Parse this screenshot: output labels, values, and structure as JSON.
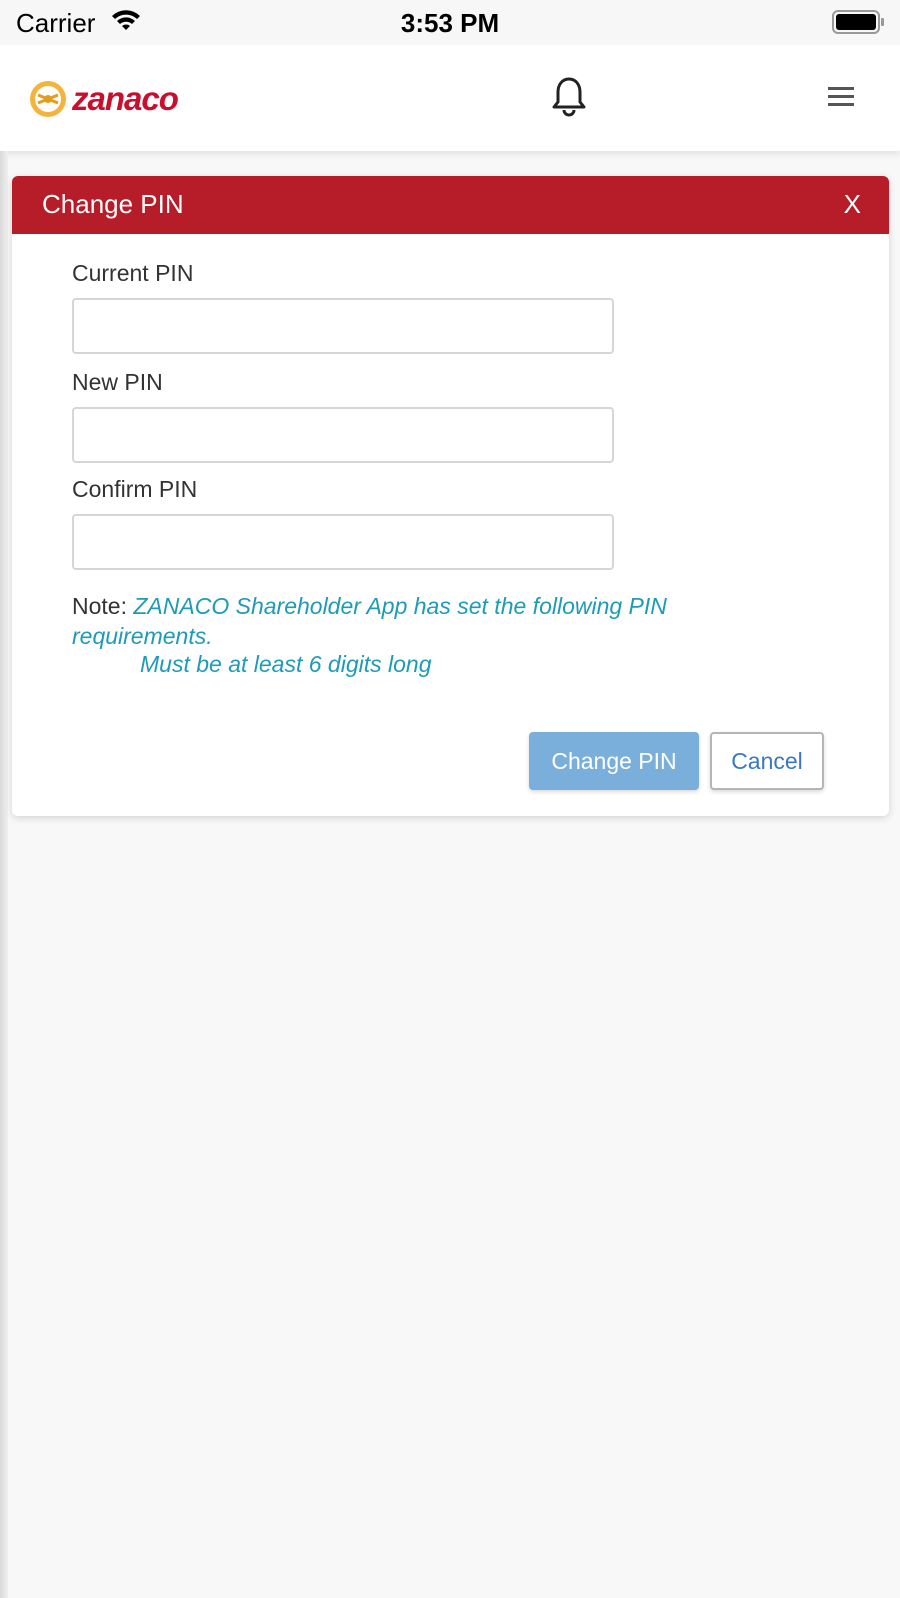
{
  "status_bar": {
    "carrier": "Carrier",
    "time": "3:53 PM",
    "icons": [
      "wifi-icon",
      "battery-icon"
    ]
  },
  "header": {
    "logo_text": "zanaco",
    "brand_color": "#c8102e",
    "icons": [
      "bell-icon",
      "menu-icon"
    ]
  },
  "dialog": {
    "title": "Change PIN",
    "close_label": "X",
    "header_color": "#b71c29",
    "fields": [
      {
        "label": "Current PIN",
        "value": ""
      },
      {
        "label": "New PIN",
        "value": ""
      },
      {
        "label": "Confirm PIN",
        "value": ""
      }
    ],
    "note_prefix": "Note:",
    "note_text": "ZANACO Shareholder App has set the following PIN requirements.",
    "requirement": "Must be at least 6 digits long",
    "note_color": "#1f9bb5",
    "primary_button": "Change PIN",
    "cancel_button": "Cancel"
  }
}
